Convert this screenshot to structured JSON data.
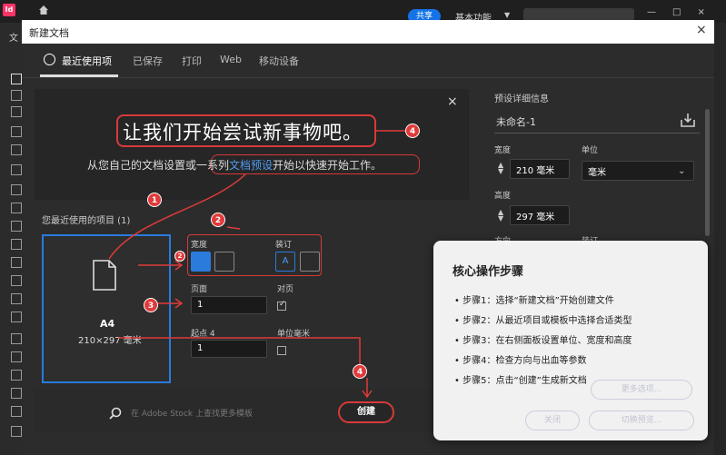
{
  "app": {
    "logo": "Id",
    "share_label": "共享",
    "workspace_label": "基本功能",
    "left_clip_label": "文"
  },
  "dialog": {
    "title": "新建文档",
    "close": "×",
    "tabs": [
      "最近使用项",
      "已保存",
      "打印",
      "Web",
      "移动设备"
    ]
  },
  "hero": {
    "title": "让我们开始尝试新事物吧。",
    "subtitle_pre": "从您自己的文档设置或一系列",
    "subtitle_link": "文档预设",
    "subtitle_post": "开始以快速开始工作。",
    "close": "×"
  },
  "recent": {
    "label": "您最近使用的项目 (1)",
    "item": {
      "name": "A4",
      "size": "210×297 毫米"
    }
  },
  "settings": {
    "orientation_label": "宽度",
    "binding_label": "装订",
    "pages_label": "页面",
    "pages_value": "1",
    "facing_label": "对页",
    "facing_checked": true,
    "start_label": "起点 4",
    "start_value": "1",
    "units_label": "单位毫米",
    "units_checked": false
  },
  "stock": {
    "placeholder": "在 Adobe Stock 上查找更多模板",
    "create_label": "创建"
  },
  "preset": {
    "title": "预设详细信息",
    "name": "未命名-1",
    "width_label": "宽度",
    "width_value": "210 毫米",
    "unit_label": "单位",
    "unit_value": "毫米",
    "height_label": "高度",
    "height_value": "297 毫米",
    "orientation_label": "方向",
    "binding_label": "装订"
  },
  "steps_card": {
    "title": "核心操作步骤",
    "steps": [
      "• 步骤1：选择“新建文档”开始创建文件",
      "• 步骤2：从最近项目或模板中选择合适类型",
      "• 步骤3：在右侧面板设置单位、宽度和高度",
      "• 步骤4：检查方向与出血等参数",
      "• 步骤5：点击“创建”生成新文档"
    ],
    "ghost_more": "更多选项...",
    "ghost_close": "关闭",
    "ghost_preview": "切换预览..."
  },
  "annotations": {
    "badges": [
      "4",
      "1",
      "2",
      "2",
      "3",
      "4"
    ]
  },
  "colors": {
    "accent_blue": "#2a7bdc",
    "annotation_red": "#d73a3a",
    "share_blue": "#1473e6"
  }
}
